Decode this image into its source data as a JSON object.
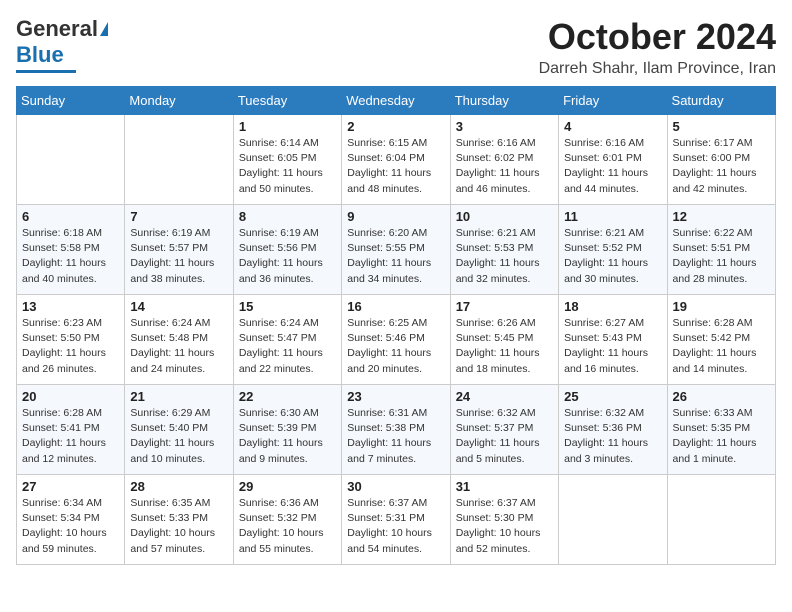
{
  "header": {
    "logo": {
      "line1": "General",
      "line2": "Blue"
    },
    "title": "October 2024",
    "location": "Darreh Shahr, Ilam Province, Iran"
  },
  "weekdays": [
    "Sunday",
    "Monday",
    "Tuesday",
    "Wednesday",
    "Thursday",
    "Friday",
    "Saturday"
  ],
  "weeks": [
    [
      {
        "day": "",
        "sunrise": "",
        "sunset": "",
        "daylight": ""
      },
      {
        "day": "",
        "sunrise": "",
        "sunset": "",
        "daylight": ""
      },
      {
        "day": "1",
        "sunrise": "Sunrise: 6:14 AM",
        "sunset": "Sunset: 6:05 PM",
        "daylight": "Daylight: 11 hours and 50 minutes."
      },
      {
        "day": "2",
        "sunrise": "Sunrise: 6:15 AM",
        "sunset": "Sunset: 6:04 PM",
        "daylight": "Daylight: 11 hours and 48 minutes."
      },
      {
        "day": "3",
        "sunrise": "Sunrise: 6:16 AM",
        "sunset": "Sunset: 6:02 PM",
        "daylight": "Daylight: 11 hours and 46 minutes."
      },
      {
        "day": "4",
        "sunrise": "Sunrise: 6:16 AM",
        "sunset": "Sunset: 6:01 PM",
        "daylight": "Daylight: 11 hours and 44 minutes."
      },
      {
        "day": "5",
        "sunrise": "Sunrise: 6:17 AM",
        "sunset": "Sunset: 6:00 PM",
        "daylight": "Daylight: 11 hours and 42 minutes."
      }
    ],
    [
      {
        "day": "6",
        "sunrise": "Sunrise: 6:18 AM",
        "sunset": "Sunset: 5:58 PM",
        "daylight": "Daylight: 11 hours and 40 minutes."
      },
      {
        "day": "7",
        "sunrise": "Sunrise: 6:19 AM",
        "sunset": "Sunset: 5:57 PM",
        "daylight": "Daylight: 11 hours and 38 minutes."
      },
      {
        "day": "8",
        "sunrise": "Sunrise: 6:19 AM",
        "sunset": "Sunset: 5:56 PM",
        "daylight": "Daylight: 11 hours and 36 minutes."
      },
      {
        "day": "9",
        "sunrise": "Sunrise: 6:20 AM",
        "sunset": "Sunset: 5:55 PM",
        "daylight": "Daylight: 11 hours and 34 minutes."
      },
      {
        "day": "10",
        "sunrise": "Sunrise: 6:21 AM",
        "sunset": "Sunset: 5:53 PM",
        "daylight": "Daylight: 11 hours and 32 minutes."
      },
      {
        "day": "11",
        "sunrise": "Sunrise: 6:21 AM",
        "sunset": "Sunset: 5:52 PM",
        "daylight": "Daylight: 11 hours and 30 minutes."
      },
      {
        "day": "12",
        "sunrise": "Sunrise: 6:22 AM",
        "sunset": "Sunset: 5:51 PM",
        "daylight": "Daylight: 11 hours and 28 minutes."
      }
    ],
    [
      {
        "day": "13",
        "sunrise": "Sunrise: 6:23 AM",
        "sunset": "Sunset: 5:50 PM",
        "daylight": "Daylight: 11 hours and 26 minutes."
      },
      {
        "day": "14",
        "sunrise": "Sunrise: 6:24 AM",
        "sunset": "Sunset: 5:48 PM",
        "daylight": "Daylight: 11 hours and 24 minutes."
      },
      {
        "day": "15",
        "sunrise": "Sunrise: 6:24 AM",
        "sunset": "Sunset: 5:47 PM",
        "daylight": "Daylight: 11 hours and 22 minutes."
      },
      {
        "day": "16",
        "sunrise": "Sunrise: 6:25 AM",
        "sunset": "Sunset: 5:46 PM",
        "daylight": "Daylight: 11 hours and 20 minutes."
      },
      {
        "day": "17",
        "sunrise": "Sunrise: 6:26 AM",
        "sunset": "Sunset: 5:45 PM",
        "daylight": "Daylight: 11 hours and 18 minutes."
      },
      {
        "day": "18",
        "sunrise": "Sunrise: 6:27 AM",
        "sunset": "Sunset: 5:43 PM",
        "daylight": "Daylight: 11 hours and 16 minutes."
      },
      {
        "day": "19",
        "sunrise": "Sunrise: 6:28 AM",
        "sunset": "Sunset: 5:42 PM",
        "daylight": "Daylight: 11 hours and 14 minutes."
      }
    ],
    [
      {
        "day": "20",
        "sunrise": "Sunrise: 6:28 AM",
        "sunset": "Sunset: 5:41 PM",
        "daylight": "Daylight: 11 hours and 12 minutes."
      },
      {
        "day": "21",
        "sunrise": "Sunrise: 6:29 AM",
        "sunset": "Sunset: 5:40 PM",
        "daylight": "Daylight: 11 hours and 10 minutes."
      },
      {
        "day": "22",
        "sunrise": "Sunrise: 6:30 AM",
        "sunset": "Sunset: 5:39 PM",
        "daylight": "Daylight: 11 hours and 9 minutes."
      },
      {
        "day": "23",
        "sunrise": "Sunrise: 6:31 AM",
        "sunset": "Sunset: 5:38 PM",
        "daylight": "Daylight: 11 hours and 7 minutes."
      },
      {
        "day": "24",
        "sunrise": "Sunrise: 6:32 AM",
        "sunset": "Sunset: 5:37 PM",
        "daylight": "Daylight: 11 hours and 5 minutes."
      },
      {
        "day": "25",
        "sunrise": "Sunrise: 6:32 AM",
        "sunset": "Sunset: 5:36 PM",
        "daylight": "Daylight: 11 hours and 3 minutes."
      },
      {
        "day": "26",
        "sunrise": "Sunrise: 6:33 AM",
        "sunset": "Sunset: 5:35 PM",
        "daylight": "Daylight: 11 hours and 1 minute."
      }
    ],
    [
      {
        "day": "27",
        "sunrise": "Sunrise: 6:34 AM",
        "sunset": "Sunset: 5:34 PM",
        "daylight": "Daylight: 10 hours and 59 minutes."
      },
      {
        "day": "28",
        "sunrise": "Sunrise: 6:35 AM",
        "sunset": "Sunset: 5:33 PM",
        "daylight": "Daylight: 10 hours and 57 minutes."
      },
      {
        "day": "29",
        "sunrise": "Sunrise: 6:36 AM",
        "sunset": "Sunset: 5:32 PM",
        "daylight": "Daylight: 10 hours and 55 minutes."
      },
      {
        "day": "30",
        "sunrise": "Sunrise: 6:37 AM",
        "sunset": "Sunset: 5:31 PM",
        "daylight": "Daylight: 10 hours and 54 minutes."
      },
      {
        "day": "31",
        "sunrise": "Sunrise: 6:37 AM",
        "sunset": "Sunset: 5:30 PM",
        "daylight": "Daylight: 10 hours and 52 minutes."
      },
      {
        "day": "",
        "sunrise": "",
        "sunset": "",
        "daylight": ""
      },
      {
        "day": "",
        "sunrise": "",
        "sunset": "",
        "daylight": ""
      }
    ]
  ]
}
